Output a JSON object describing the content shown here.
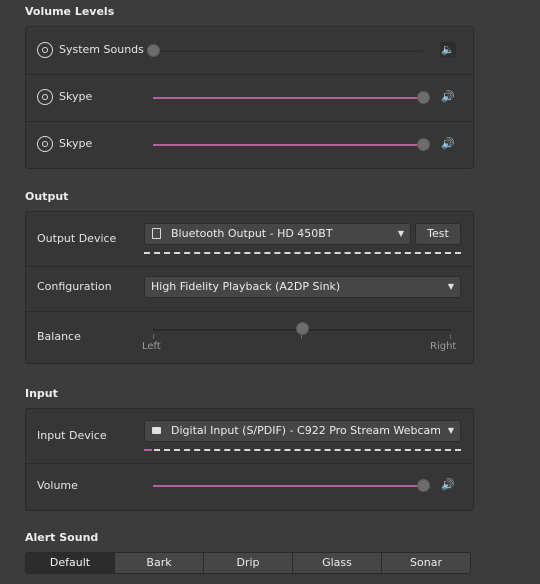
{
  "volume_levels": {
    "title": "Volume Levels",
    "apps": [
      {
        "name": "System Sounds",
        "level": 0.0,
        "muted": true
      },
      {
        "name": "Skype",
        "level": 1.0,
        "muted": false
      },
      {
        "name": "Skype",
        "level": 1.0,
        "muted": false
      }
    ]
  },
  "output": {
    "title": "Output",
    "device_label": "Output Device",
    "device_value": "Bluetooth Output - HD 450BT",
    "test_label": "Test",
    "config_label": "Configuration",
    "config_value": "High Fidelity Playback (A2DP Sink)",
    "balance_label": "Balance",
    "balance_left": "Left",
    "balance_right": "Right",
    "balance_value": 0.5
  },
  "input": {
    "title": "Input",
    "device_label": "Input Device",
    "device_value": "Digital Input (S/PDIF) - C922 Pro Stream Webcam",
    "volume_label": "Volume",
    "volume_level": 1.0
  },
  "alert_sound": {
    "title": "Alert Sound",
    "options": [
      "Default",
      "Bark",
      "Drip",
      "Glass",
      "Sonar"
    ],
    "selected": "Default"
  },
  "colors": {
    "accent": "#b0649a",
    "background": "#3c3c3c",
    "panel": "#363636"
  },
  "icons": {
    "app": "app-gear-icon",
    "speaker": "speaker-icon",
    "dropdown": "chevron-down-icon",
    "device": "device-icon"
  }
}
